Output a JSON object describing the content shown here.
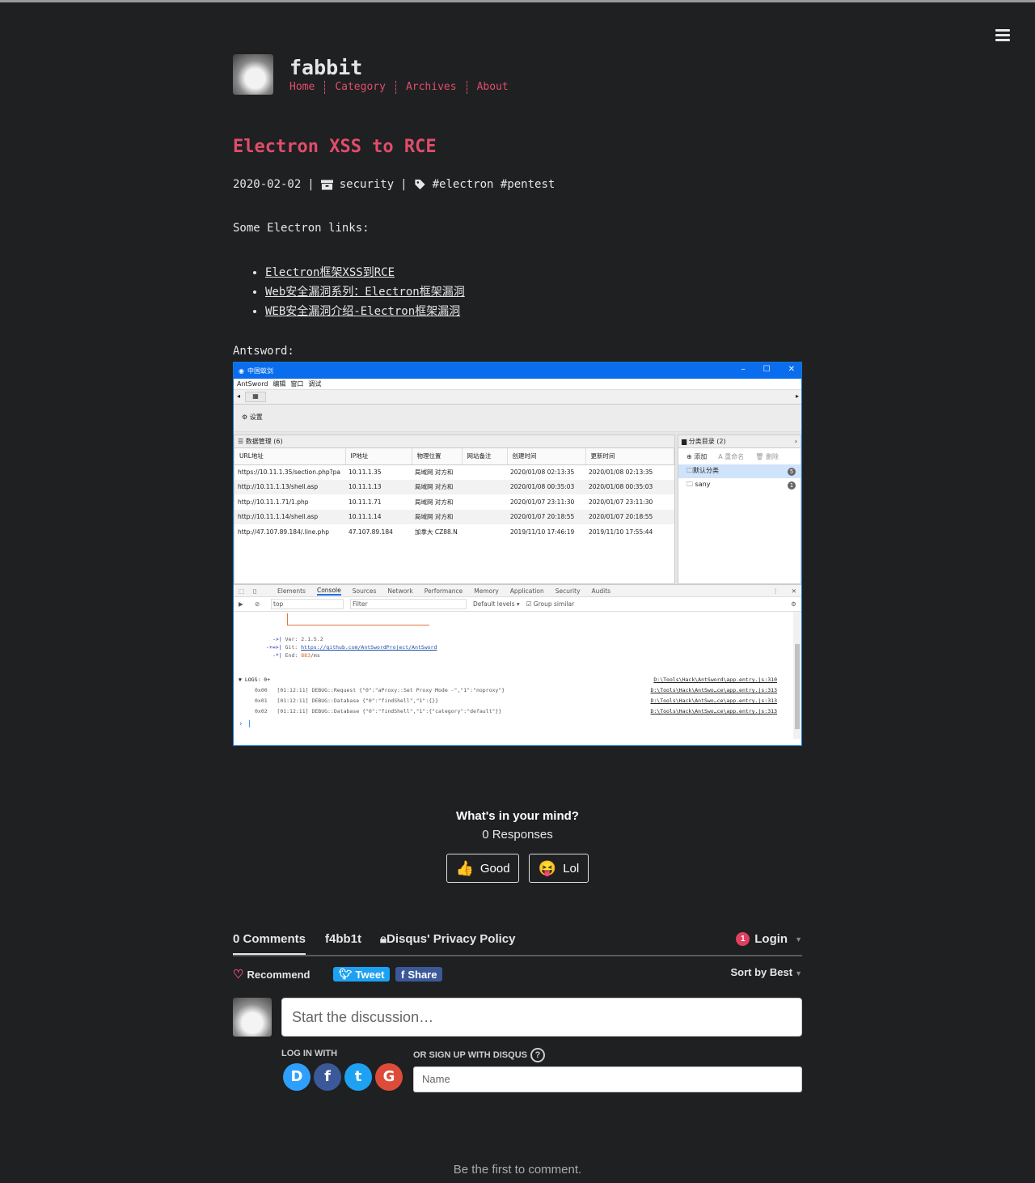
{
  "site": {
    "title": "fabbit",
    "nav": [
      "Home",
      "Category",
      "Archives",
      "About"
    ]
  },
  "post": {
    "title": "Electron XSS to RCE",
    "date": "2020-02-02",
    "category": "security",
    "tags": "#electron #pentest",
    "intro": "Some Electron links:",
    "links": [
      "Electron框架XSS到RCE",
      "Web安全漏洞系列：Electron框架漏洞",
      "WEB安全漏洞介绍-Electron框架漏洞"
    ],
    "antsword_label": "Antsword:"
  },
  "screenshot": {
    "window_title": "中国蚁剑",
    "menu": [
      "AntSword",
      "编辑",
      "窗口",
      "调试"
    ],
    "toolbar_label": "设置",
    "data_panel_title": "数据管理 (6)",
    "columns": [
      "URL地址",
      "IP地址",
      "物理位置",
      "网站备注",
      "创建时间",
      "更新时间"
    ],
    "rows": [
      [
        "https://10.11.1.35/section.php?pa",
        "10.11.1.35",
        "局域网 对方和",
        "",
        "2020/01/08 02:13:35",
        "2020/01/08 02:13:35"
      ],
      [
        "http://10.11.1.13/shell.asp",
        "10.11.1.13",
        "局域网 对方和",
        "",
        "2020/01/08 00:35:03",
        "2020/01/08 00:35:03"
      ],
      [
        "http://10.11.1.71/1.php",
        "10.11.1.71",
        "局域网 对方和",
        "",
        "2020/01/07 23:11:30",
        "2020/01/07 23:11:30"
      ],
      [
        "http://10.11.1.14/shell.asp",
        "10.11.1.14",
        "局域网 对方和",
        "",
        "2020/01/07 20:18:55",
        "2020/01/07 20:18:55"
      ],
      [
        "http://47.107.89.184/.line.php",
        "47.107.89.184",
        "加拿大 CZ88.N",
        "",
        "2019/11/10 17:46:19",
        "2019/11/10 17:55:44"
      ]
    ],
    "category_title": "分类目录 (2)",
    "category_tools": [
      "添加",
      "重命名",
      "删除"
    ],
    "categories": [
      {
        "name": "默认分类",
        "count": "5"
      },
      {
        "name": "sany",
        "count": "1"
      }
    ],
    "devtools_tabs": [
      "Elements",
      "Console",
      "Sources",
      "Network",
      "Performance",
      "Memory",
      "Application",
      "Security",
      "Audits"
    ],
    "devtools_context": "top",
    "devtools_filter": "Filter",
    "devtools_levels": "Default levels ▾",
    "devtools_group": "Group similar",
    "console_ver": "Ver: 2.1.5.2",
    "console_git_label": "Git:",
    "console_git": "https://github.com/AntSwordProject/AntSword",
    "console_end_label": "End:",
    "console_end": "883",
    "console_end_unit": "/ms",
    "logs_label": "▼ LOGS: 0+",
    "logs_src": "D:\\Tools\\Hack\\AntSword\\app.entry.js:310",
    "logs": [
      {
        "id": "0x00",
        "text": "[01:12:11] DEBUG::Request  {\"0\":\"aProxy::Set Proxy Mode -\",\"1\":\"noproxy\"}",
        "src": "D:\\Tools\\Hack\\AntSwo…ce\\app.entry.js:313"
      },
      {
        "id": "0x01",
        "text": "[01:12:11] DEBUG::Database  {\"0\":\"findShell\",\"1\":{}}",
        "src": "D:\\Tools\\Hack\\AntSwo…ce\\app.entry.js:313"
      },
      {
        "id": "0x02",
        "text": "[01:12:11] DEBUG::Database  {\"0\":\"findShell\",\"1\":{\"category\":\"default\"}}",
        "src": "D:\\Tools\\Hack\\AntSwo…ce\\app.entry.js:313"
      }
    ]
  },
  "reactions": {
    "question": "What's in your mind?",
    "responses": "0 Responses",
    "good": "Good",
    "lol": "Lol"
  },
  "disqus": {
    "comments_tab": "0 Comments",
    "community_tab": "f4bb1t",
    "privacy": "Disqus' Privacy Policy",
    "login": "Login",
    "notif_count": "1",
    "recommend": "Recommend",
    "tweet": "Tweet",
    "share": "Share",
    "sort": "Sort by Best",
    "placeholder": "Start the discussion…",
    "log_in_with": "LOG IN WITH",
    "sign_up": "OR SIGN UP WITH DISQUS",
    "name_placeholder": "Name",
    "empty": "Be the first to comment."
  },
  "colors": {
    "background": "#1f2022",
    "accent": "#e04d6b",
    "text": "#e6e6e6"
  }
}
